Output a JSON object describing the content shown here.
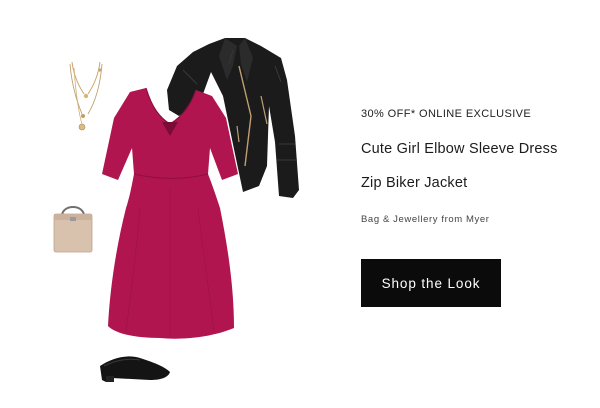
{
  "promo": {
    "headline": "30% OFF* ONLINE EXCLUSIVE"
  },
  "products": [
    {
      "name": "Cute Girl Elbow Sleeve Dress"
    },
    {
      "name": "Zip Biker Jacket"
    }
  ],
  "credit": "Bag & Jewellery from Myer",
  "cta": {
    "label": "Shop the Look"
  },
  "colors": {
    "dress": "#b0154f",
    "jacket": "#1b1b1b",
    "bag": "#d8c1ad",
    "shoe": "#141414",
    "jewellery": "#c9a46a",
    "button": "#0b0b0b"
  },
  "items": [
    "necklace-image",
    "jacket-image",
    "dress-image",
    "bag-image",
    "shoe-image"
  ]
}
